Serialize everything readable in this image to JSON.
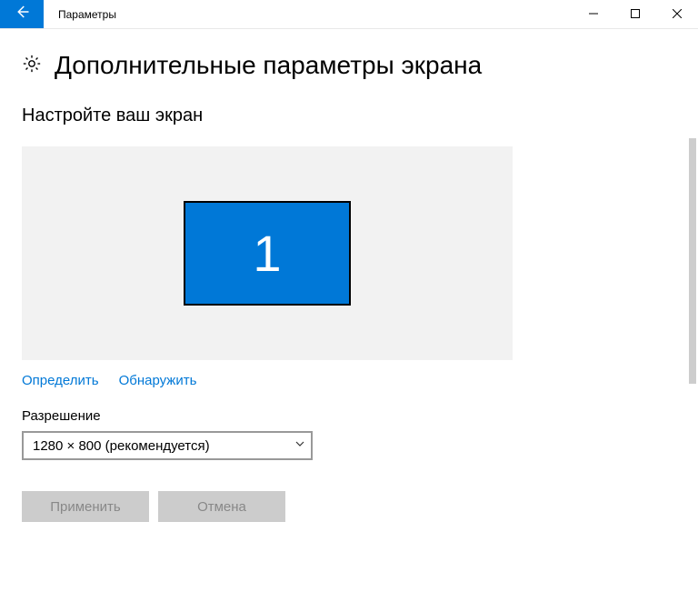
{
  "window": {
    "title": "Параметры"
  },
  "page": {
    "heading": "Дополнительные параметры экрана",
    "section_heading": "Настройте ваш экран"
  },
  "display_preview": {
    "monitor_number": "1"
  },
  "links": {
    "identify": "Определить",
    "detect": "Обнаружить"
  },
  "resolution": {
    "label": "Разрешение",
    "selected": "1280 × 800 (рекомендуется)"
  },
  "buttons": {
    "apply": "Применить",
    "cancel": "Отмена"
  }
}
